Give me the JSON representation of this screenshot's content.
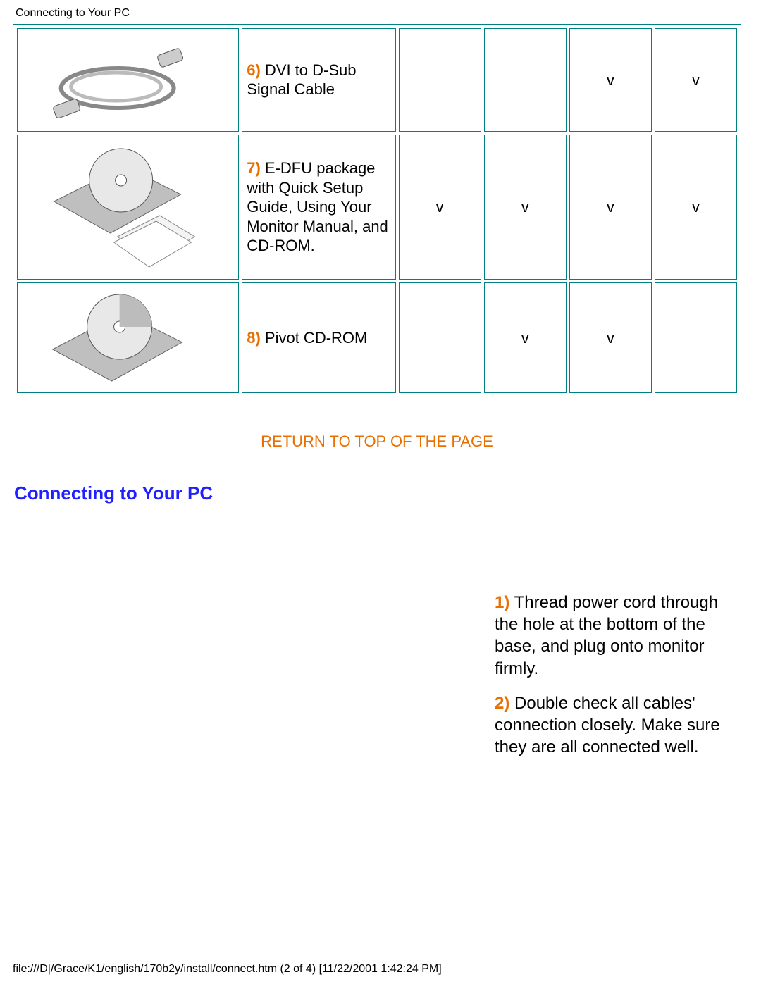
{
  "header": "Connecting to Your PC",
  "table": {
    "rows": [
      {
        "num": "6)",
        "desc": " DVI to D-Sub Signal Cable",
        "c1": "",
        "c2": "",
        "c3": "v",
        "c4": "v"
      },
      {
        "num": "7)",
        "desc": " E-DFU package with Quick Setup Guide, Using Your Monitor Manual, and CD-ROM.",
        "c1": "v",
        "c2": "v",
        "c3": "v",
        "c4": "v"
      },
      {
        "num": "8)",
        "desc": " Pivot CD-ROM",
        "c1": "",
        "c2": "v",
        "c3": "v",
        "c4": ""
      }
    ]
  },
  "return_link": "RETURN TO TOP OF THE PAGE",
  "section_heading": "Connecting to Your PC",
  "steps": [
    {
      "num": "1)",
      "text": " Thread power cord through the hole at the bottom of the base, and plug onto monitor firmly."
    },
    {
      "num": "2)",
      "text": " Double check all cables' connection closely. Make sure they are all connected well."
    }
  ],
  "footer": "file:///D|/Grace/K1/english/170b2y/install/connect.htm (2 of 4) [11/22/2001 1:42:24 PM]"
}
